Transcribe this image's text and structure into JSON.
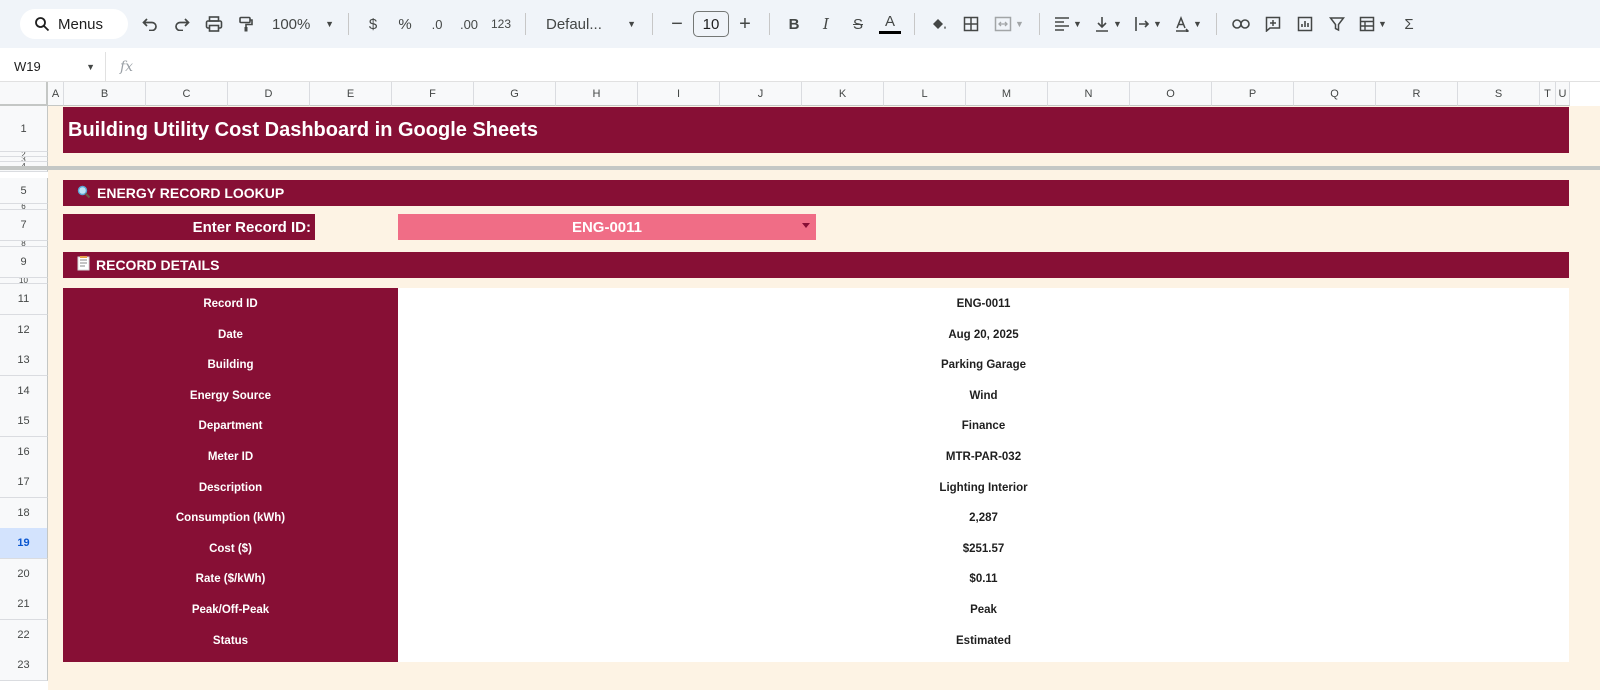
{
  "toolbar": {
    "menus_label": "Menus",
    "zoom": "100%",
    "currency": "$",
    "percent": "%",
    "decrease_decimal": ".0",
    "increase_decimal": ".00",
    "number_format": "123",
    "font": "Defaul...",
    "font_size": "10",
    "bold": "B",
    "italic": "I",
    "strike": "S",
    "text_color": "A",
    "sum": "Σ"
  },
  "formula_bar": {
    "cell_ref": "W19",
    "fx": "fx"
  },
  "columns": [
    "A",
    "B",
    "C",
    "D",
    "E",
    "F",
    "G",
    "H",
    "I",
    "J",
    "K",
    "L",
    "M",
    "N",
    "O",
    "P",
    "Q",
    "R",
    "S",
    "T",
    "U"
  ],
  "rows": [
    "1",
    "2",
    "3",
    "4",
    "5",
    "6",
    "7",
    "8",
    "9",
    "10",
    "11",
    "12",
    "13",
    "14",
    "15",
    "16",
    "17",
    "18",
    "19",
    "20",
    "21",
    "22",
    "23"
  ],
  "selected_row": "19",
  "sheet": {
    "title": "Building Utility Cost Dashboard in Google Sheets",
    "lookup_header": "ENERGY RECORD LOOKUP",
    "lookup_icon": "magnifier-icon",
    "record_prompt": "Enter Record ID:",
    "record_id_value": "ENG-0011",
    "details_header": "RECORD DETAILS",
    "details_icon": "memo-icon",
    "details": [
      {
        "label": "Record ID",
        "value": "ENG-0011"
      },
      {
        "label": "Date",
        "value": "Aug 20, 2025"
      },
      {
        "label": "Building",
        "value": "Parking Garage"
      },
      {
        "label": "Energy Source",
        "value": "Wind"
      },
      {
        "label": "Department",
        "value": "Finance"
      },
      {
        "label": "Meter ID",
        "value": "MTR-PAR-032"
      },
      {
        "label": "Description",
        "value": "Lighting Interior"
      },
      {
        "label": "Consumption (kWh)",
        "value": "2,287"
      },
      {
        "label": "Cost ($)",
        "value": "$251.57"
      },
      {
        "label": "Rate ($/kWh)",
        "value": "$0.11"
      },
      {
        "label": "Peak/Off-Peak",
        "value": "Peak"
      },
      {
        "label": "Status",
        "value": "Estimated"
      }
    ]
  },
  "colors": {
    "banner": "#870f35",
    "dropdown": "#f06d86",
    "sheet_background": "#fdf3e4",
    "toolbar_background": "#f0f4f9"
  }
}
